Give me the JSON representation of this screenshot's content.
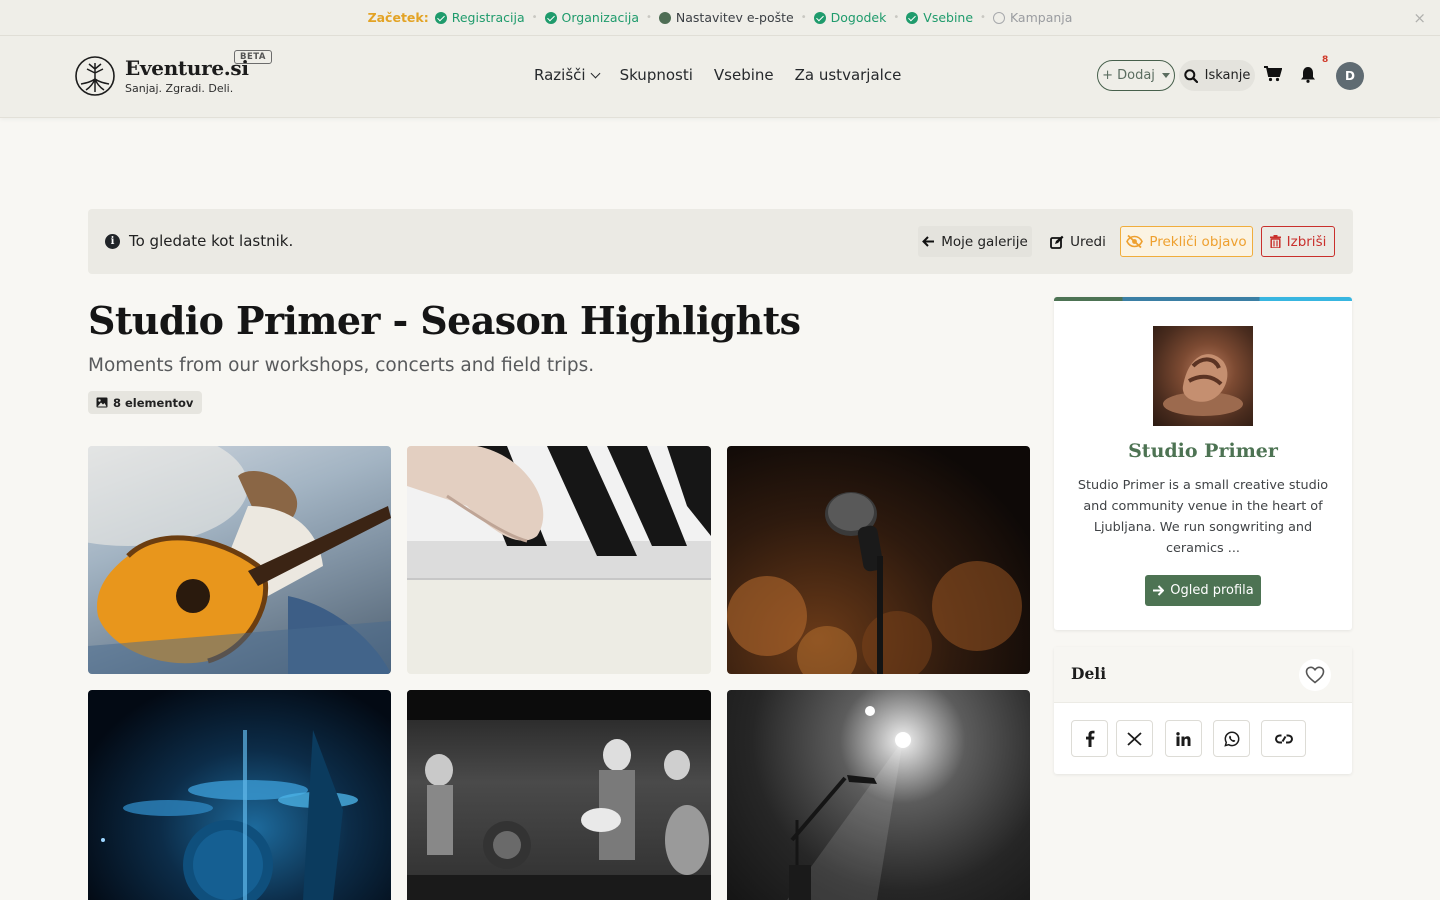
{
  "onboarding": {
    "lead": "Začetek:",
    "steps": [
      {
        "label": "Registracija",
        "state": "done"
      },
      {
        "label": "Organizacija",
        "state": "done"
      },
      {
        "label": "Nastavitev e-pošte",
        "state": "current"
      },
      {
        "label": "Dogodek",
        "state": "done"
      },
      {
        "label": "Vsebine",
        "state": "done"
      },
      {
        "label": "Kampanja",
        "state": "todo"
      }
    ],
    "close": "×"
  },
  "header": {
    "brand": {
      "name": "Eventure.si",
      "tagline": "Sanjaj. Zgradi. Deli.",
      "badge": "BETA"
    },
    "nav": [
      {
        "label": "Razišči",
        "has_dropdown": true
      },
      {
        "label": "Skupnosti"
      },
      {
        "label": "Vsebine"
      },
      {
        "label": "Za ustvarjalce"
      }
    ],
    "add_button": "+ Dodaj",
    "search_button": "Iskanje",
    "notification_count": "8",
    "avatar_initial": "D"
  },
  "owner_bar": {
    "message": "To gledate kot lastnik.",
    "back": "Moje galerije",
    "edit": "Uredi",
    "unpublish": "Prekliči objavo",
    "delete": "Izbriši"
  },
  "gallery": {
    "title": "Studio Primer - Season Highlights",
    "subtitle": "Moments from our workshops, concerts and field trips.",
    "count": "8 elementov",
    "items": [
      {
        "icon": "guitar-photo"
      },
      {
        "icon": "piano-photo"
      },
      {
        "icon": "microphone-photo"
      },
      {
        "icon": "drums-photo"
      },
      {
        "icon": "band-photo"
      },
      {
        "icon": "spotlight-photo"
      }
    ]
  },
  "profile": {
    "name": "Studio Primer",
    "description": "Studio Primer is a small creative studio and community venue in the heart of Ljubljana. We run songwriting and ceramics ...",
    "button": "Ogled profila"
  },
  "share": {
    "title": "Deli",
    "buttons": [
      "facebook-icon",
      "x-icon",
      "linkedin-icon",
      "whatsapp-icon",
      "link-icon"
    ]
  },
  "colors": {
    "brand_green": "#4d7353",
    "done_green": "#1f9b6c",
    "lead_orange": "#e3a325",
    "warning": "#eea02f",
    "danger": "#c9302c"
  }
}
